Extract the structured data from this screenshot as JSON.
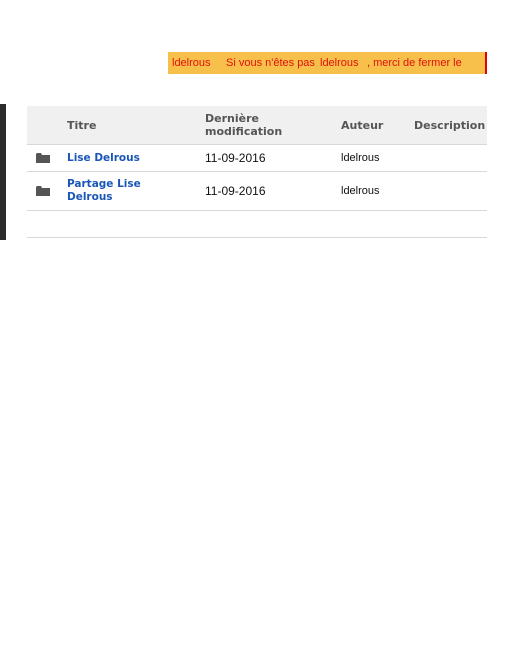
{
  "notice": {
    "user1": "ldelrous",
    "text1": "Si vous n'êtes pas",
    "user2": "ldelrous",
    "text2": ", merci de fermer le"
  },
  "table": {
    "headers": {
      "title": "Titre",
      "modified_line1": "Dernière",
      "modified_line2": "modification",
      "author": "Auteur",
      "description": "Description"
    },
    "rows": [
      {
        "icon": "folder-icon",
        "title": "Lise Delrous",
        "modified": "11-09-2016",
        "author": "ldelrous",
        "description": ""
      },
      {
        "icon": "folder-icon",
        "title_line1": "Partage Lise",
        "title_line2": "Delrous",
        "modified": "11-09-2016",
        "author": "ldelrous",
        "description": ""
      }
    ]
  },
  "colors": {
    "notice_bg": "#f7c04a",
    "notice_text": "#e01010",
    "link": "#1a56b8",
    "header_bg": "#f0f0f0"
  }
}
